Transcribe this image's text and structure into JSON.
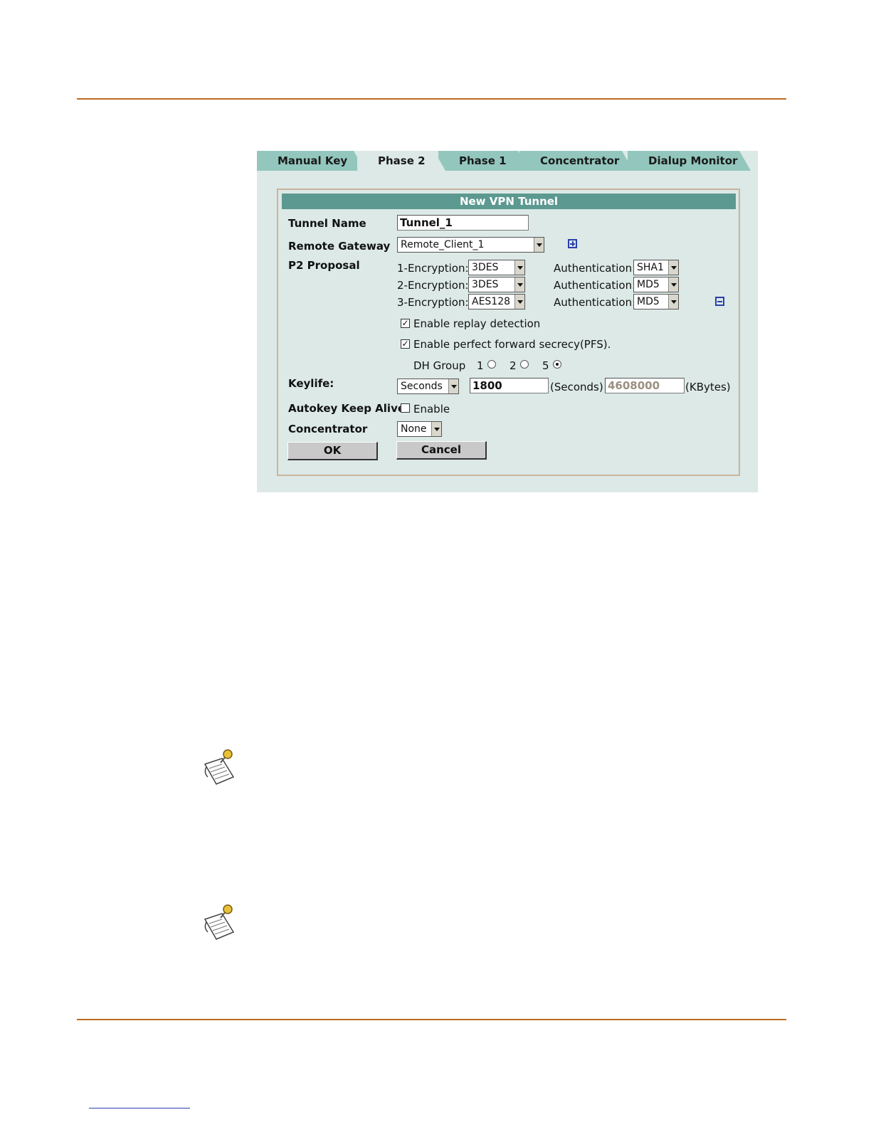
{
  "tabs": [
    "Manual Key",
    "Phase 2",
    "Phase 1",
    "Concentrator",
    "Dialup Monitor"
  ],
  "form": {
    "title": "New VPN Tunnel",
    "tunnel_name": {
      "label": "Tunnel Name",
      "value": "Tunnel_1"
    },
    "remote_gateway": {
      "label": "Remote Gateway",
      "value": "Remote_Client_1"
    },
    "p2_proposal": {
      "label": "P2 Proposal",
      "rows": [
        {
          "enc_label": "1-Encryption:",
          "enc_value": "3DES",
          "auth_label": "Authentication:",
          "auth_value": "SHA1"
        },
        {
          "enc_label": "2-Encryption:",
          "enc_value": "3DES",
          "auth_label": "Authentication:",
          "auth_value": "MD5"
        },
        {
          "enc_label": "3-Encryption:",
          "enc_value": "AES128",
          "auth_label": "Authentication:",
          "auth_value": "MD5"
        }
      ]
    },
    "replay_detection": {
      "label": "Enable replay detection",
      "checked": true
    },
    "pfs": {
      "label": "Enable perfect forward secrecy(PFS).",
      "checked": true
    },
    "dh_group": {
      "label": "DH Group",
      "options": [
        "1",
        "2",
        "5"
      ],
      "selected": "5"
    },
    "keylife": {
      "label": "Keylife:",
      "type": "Seconds",
      "seconds": "1800",
      "seconds_unit": "(Seconds)",
      "kbytes": "4608000",
      "kbytes_unit": "(KBytes)"
    },
    "autokey": {
      "label": "Autokey Keep Alive",
      "option_label": "Enable",
      "checked": false
    },
    "concentrator": {
      "label": "Concentrator",
      "value": "None"
    },
    "buttons": {
      "ok": "OK",
      "cancel": "Cancel"
    }
  },
  "icons": {
    "add": "plus-square-icon",
    "remove": "minus-square-icon",
    "note": "note-pushpin-icon"
  },
  "colors": {
    "rule": "#c06a1e",
    "tab": "#93c7be",
    "panel": "#dce9e6",
    "title_bar": "#5c9990",
    "link": "#2a3fae"
  }
}
